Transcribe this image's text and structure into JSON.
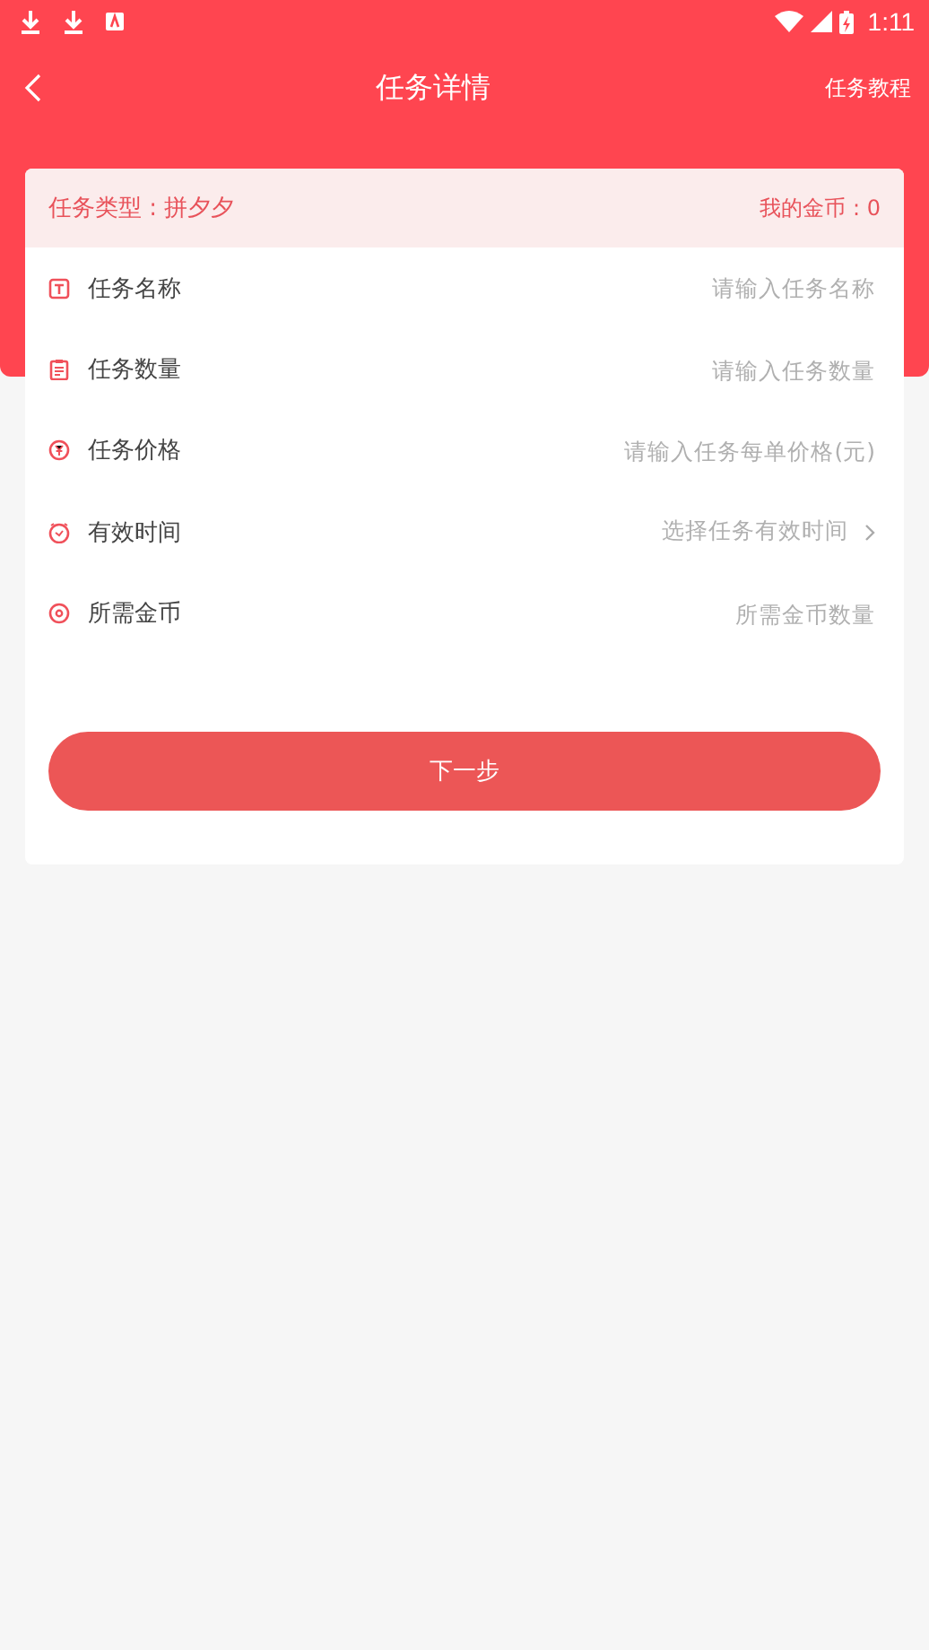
{
  "status_bar": {
    "time": "1:11"
  },
  "header": {
    "title": "任务详情",
    "action": "任务教程"
  },
  "card": {
    "type_label": "任务类型 : 拼夕夕",
    "coins": "我的金币 : 0"
  },
  "fields": [
    {
      "kind": "input",
      "label": "任务名称",
      "placeholder": "请输入任务名称"
    },
    {
      "kind": "input",
      "label": "任务数量",
      "placeholder": "请输入任务数量"
    },
    {
      "kind": "input",
      "label": "任务价格",
      "placeholder": "请输入任务每单价格(元)"
    },
    {
      "kind": "select",
      "label": "有效时间",
      "placeholder": "选择任务有效时间"
    },
    {
      "kind": "input",
      "label": "所需金币",
      "placeholder": "所需金币数量"
    }
  ],
  "next_button": "下一步"
}
